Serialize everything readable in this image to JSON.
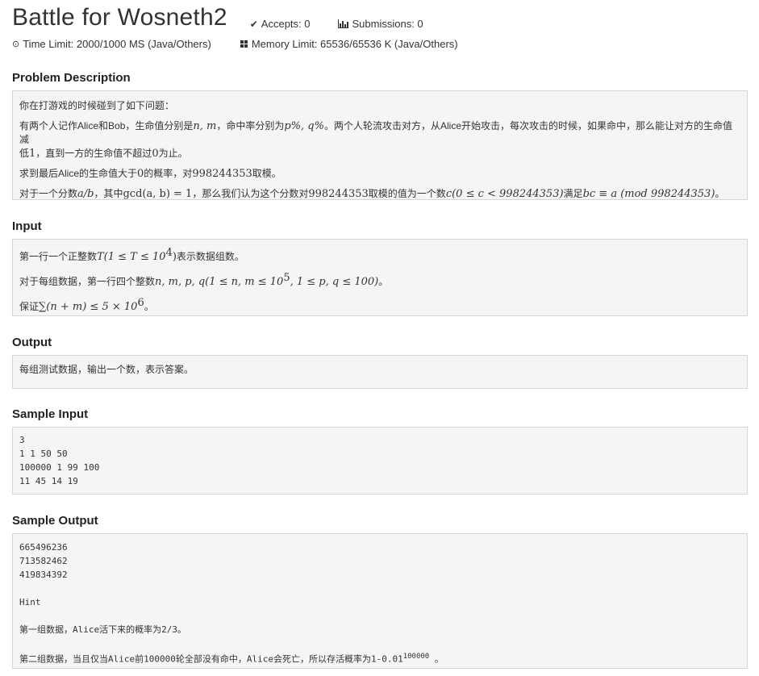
{
  "header": {
    "title": "Battle for Wosneth2",
    "accepts_label": "Accepts: 0",
    "submissions_label": "Submissions: 0",
    "time_limit": "Time Limit: 2000/1000 MS (Java/Others)",
    "memory_limit": "Memory Limit: 65536/65536 K (Java/Others)"
  },
  "sections": {
    "description": {
      "heading": "Problem Description",
      "line1": "你在打游戏的时候碰到了如下问题：",
      "line2_a": " 有两个人记作Alice和Bob，生命值分别是",
      "line2_m1": "n, m",
      "line2_b": "，命中率分别为",
      "line2_m2": "p%, q%",
      "line2_c": "。两个人轮流攻击对方，从Alice开始攻击，每次攻击的时候，如果命中，那么能让对方的生命值减",
      "line2_d": "低",
      "line2_m3": "1",
      "line2_e": "，直到一方的生命值不超过",
      "line2_m4": "0",
      "line2_f": "为止。",
      "line3_a": "求到最后Alice的生命值大于",
      "line3_m1": "0",
      "line3_b": "的概率，对",
      "line3_m2": "998244353",
      "line3_c": "取模。",
      "line4_a": "对于一个分数",
      "line4_m1": "a/b",
      "line4_b": "，其中",
      "line4_m2": "gcd(a, b) = 1",
      "line4_c": "，那么我们认为这个分数对",
      "line4_m3": "998244353",
      "line4_d": "取模的值为一个数",
      "line4_m4": "c(0 ≤ c < 998244353)",
      "line4_e": "满足",
      "line4_m5": "bc ≡ a  (mod 998244353)",
      "line4_f": "。"
    },
    "input": {
      "heading": "Input",
      "line1_a": "第一行一个正整数",
      "line1_m": "T(1 ≤ T ≤ 10",
      "line1_sup": "4",
      "line1_m2": ")",
      "line1_b": "表示数据组数。",
      "line2_a": "对于每组数据，第一行四个整数",
      "line2_m": "n, m, p, q(1 ≤ n, m ≤ 10",
      "line2_sup": "5",
      "line2_m2": ", 1 ≤ p, q ≤ 100)",
      "line2_b": "。",
      "line3_a": "保证",
      "line3_m": "∑(n + m) ≤ 5 × 10",
      "line3_sup": "6",
      "line3_b": "。"
    },
    "output": {
      "heading": "Output",
      "text": "每组测试数据，输出一个数，表示答案。"
    },
    "sample_input": {
      "heading": "Sample Input",
      "lines": [
        "3",
        "1 1 50 50",
        "100000 1 99 100",
        "11 45 14 19"
      ]
    },
    "sample_output": {
      "heading": "Sample Output",
      "lines": [
        "665496236",
        "713582462",
        "419834392",
        "",
        "Hint",
        "",
        "第一组数据，Alice活下来的概率为2/3。",
        ""
      ],
      "last_line": "第二组数据，当且仅当Alice前100000轮全部没有命中，Alice会死亡，所以存活概率为1-0.01",
      "last_sup": "100000",
      "last_tail": " 。"
    }
  }
}
